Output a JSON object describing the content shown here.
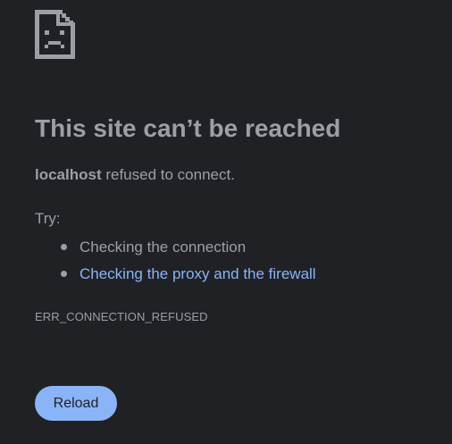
{
  "icon": "sad-page-icon",
  "title": "This site can’t be reached",
  "description": {
    "host": "localhost",
    "message": " refused to connect."
  },
  "try_label": "Try:",
  "suggestions": [
    {
      "label": "Checking the connection",
      "is_link": false
    },
    {
      "label": "Checking the proxy and the firewall",
      "is_link": true
    }
  ],
  "error_code": "ERR_CONNECTION_REFUSED",
  "reload_button": "Reload",
  "colors": {
    "background": "#202124",
    "text": "#9aa0a6",
    "link": "#8ab4f8",
    "button": "#8ab4f8"
  }
}
